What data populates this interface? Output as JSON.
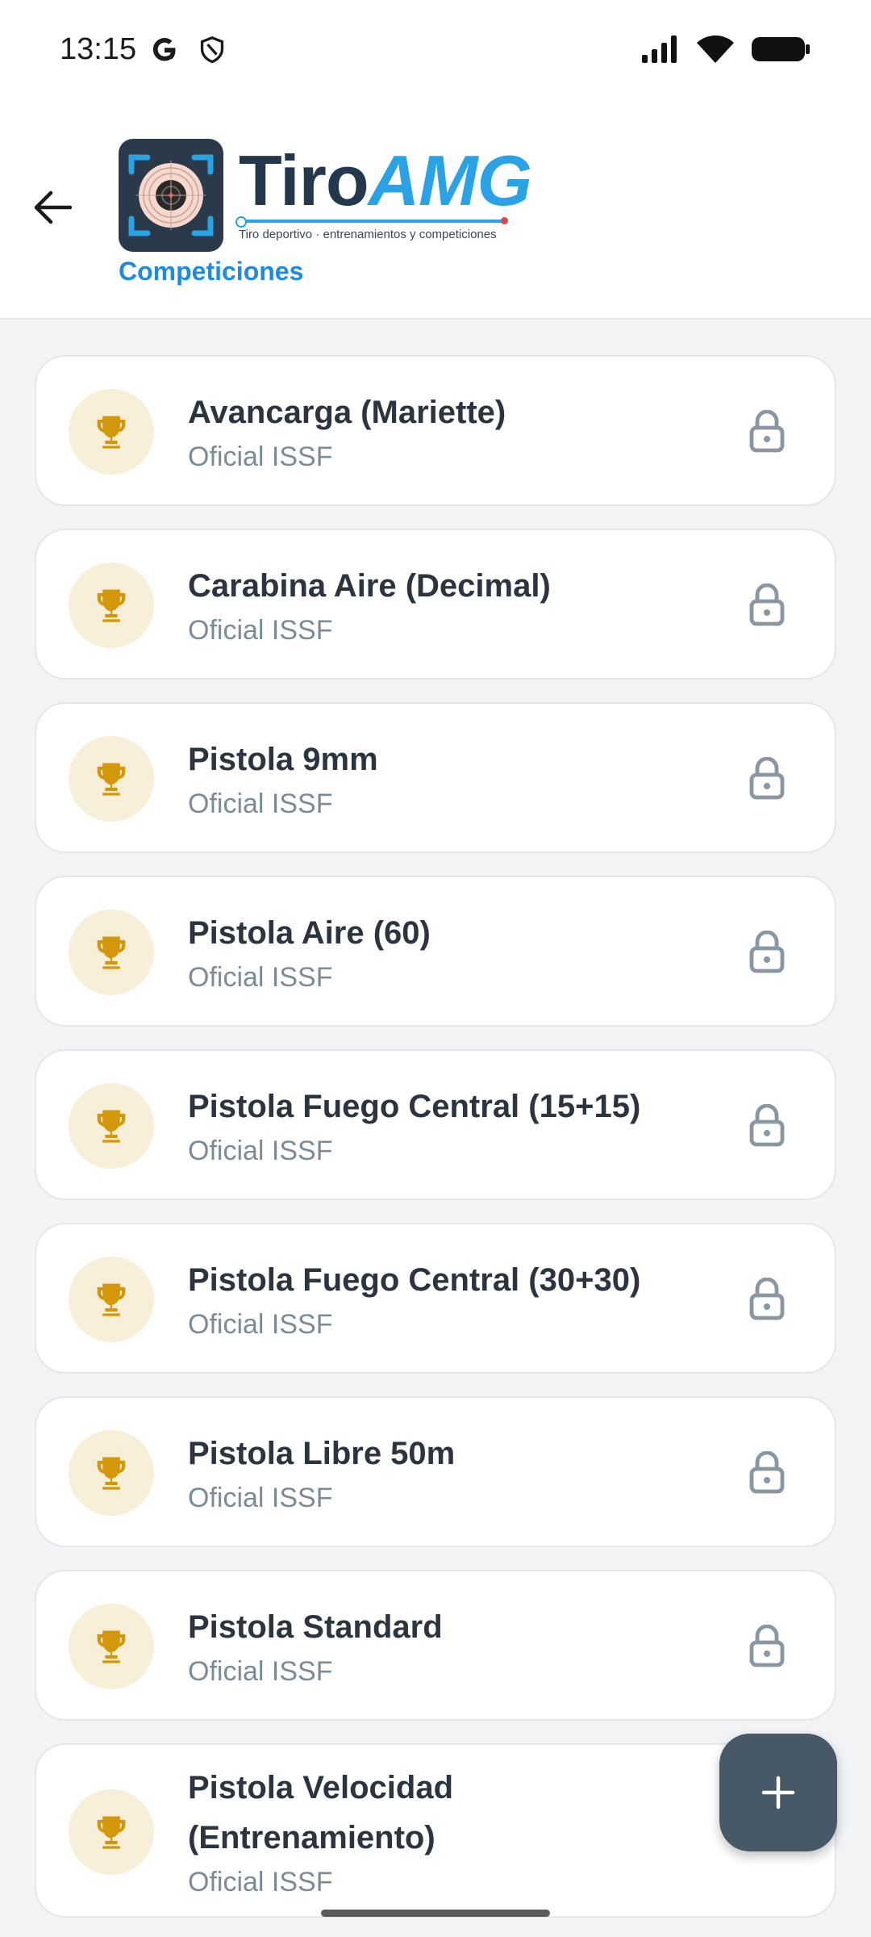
{
  "status_bar": {
    "time": "13:15"
  },
  "header": {
    "brand_tiro": "Tiro",
    "brand_amg": "AMG",
    "tagline": "Tiro deportivo · entrenamientos y competiciones",
    "section_title": "Competiciones"
  },
  "competitions": [
    {
      "title": "Avancarga (Mariette)",
      "subtitle": "Oficial ISSF"
    },
    {
      "title": "Carabina Aire (Decimal)",
      "subtitle": "Oficial ISSF"
    },
    {
      "title": "Pistola 9mm",
      "subtitle": "Oficial ISSF"
    },
    {
      "title": "Pistola Aire (60)",
      "subtitle": "Oficial ISSF"
    },
    {
      "title": "Pistola Fuego Central (15+15)",
      "subtitle": "Oficial ISSF"
    },
    {
      "title": "Pistola Fuego Central (30+30)",
      "subtitle": "Oficial ISSF"
    },
    {
      "title": "Pistola Libre 50m",
      "subtitle": "Oficial ISSF"
    },
    {
      "title": "Pistola Standard",
      "subtitle": "Oficial ISSF"
    },
    {
      "title": "Pistola Velocidad (Entrenamiento)",
      "subtitle": "Oficial ISSF"
    }
  ],
  "colors": {
    "accent": "#1f8ae0",
    "trophy": "#d4960a",
    "fab": "#475867"
  }
}
